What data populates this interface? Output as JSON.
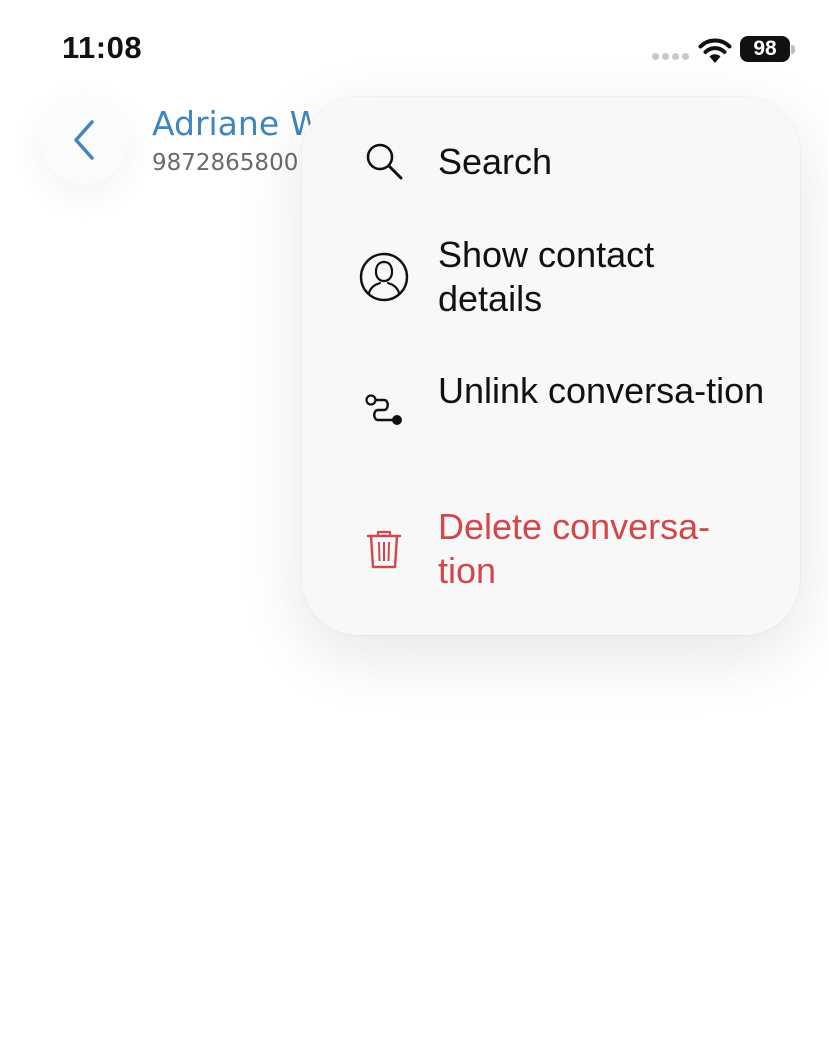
{
  "status_bar": {
    "time": "11:08",
    "battery": "98"
  },
  "header": {
    "contact_name": "Adriane W",
    "contact_phone": "9872865800"
  },
  "menu": {
    "items": [
      {
        "label": "Search",
        "icon": "search-icon"
      },
      {
        "label": "Show contact details",
        "icon": "contact-icon"
      },
      {
        "label": "Unlink conversa-tion",
        "icon": "unlink-icon"
      },
      {
        "label": "Delete conversa-tion",
        "icon": "trash-icon",
        "color": "#d2484a"
      }
    ]
  },
  "colors": {
    "accent": "#3f86bf",
    "danger": "#d2484a"
  }
}
